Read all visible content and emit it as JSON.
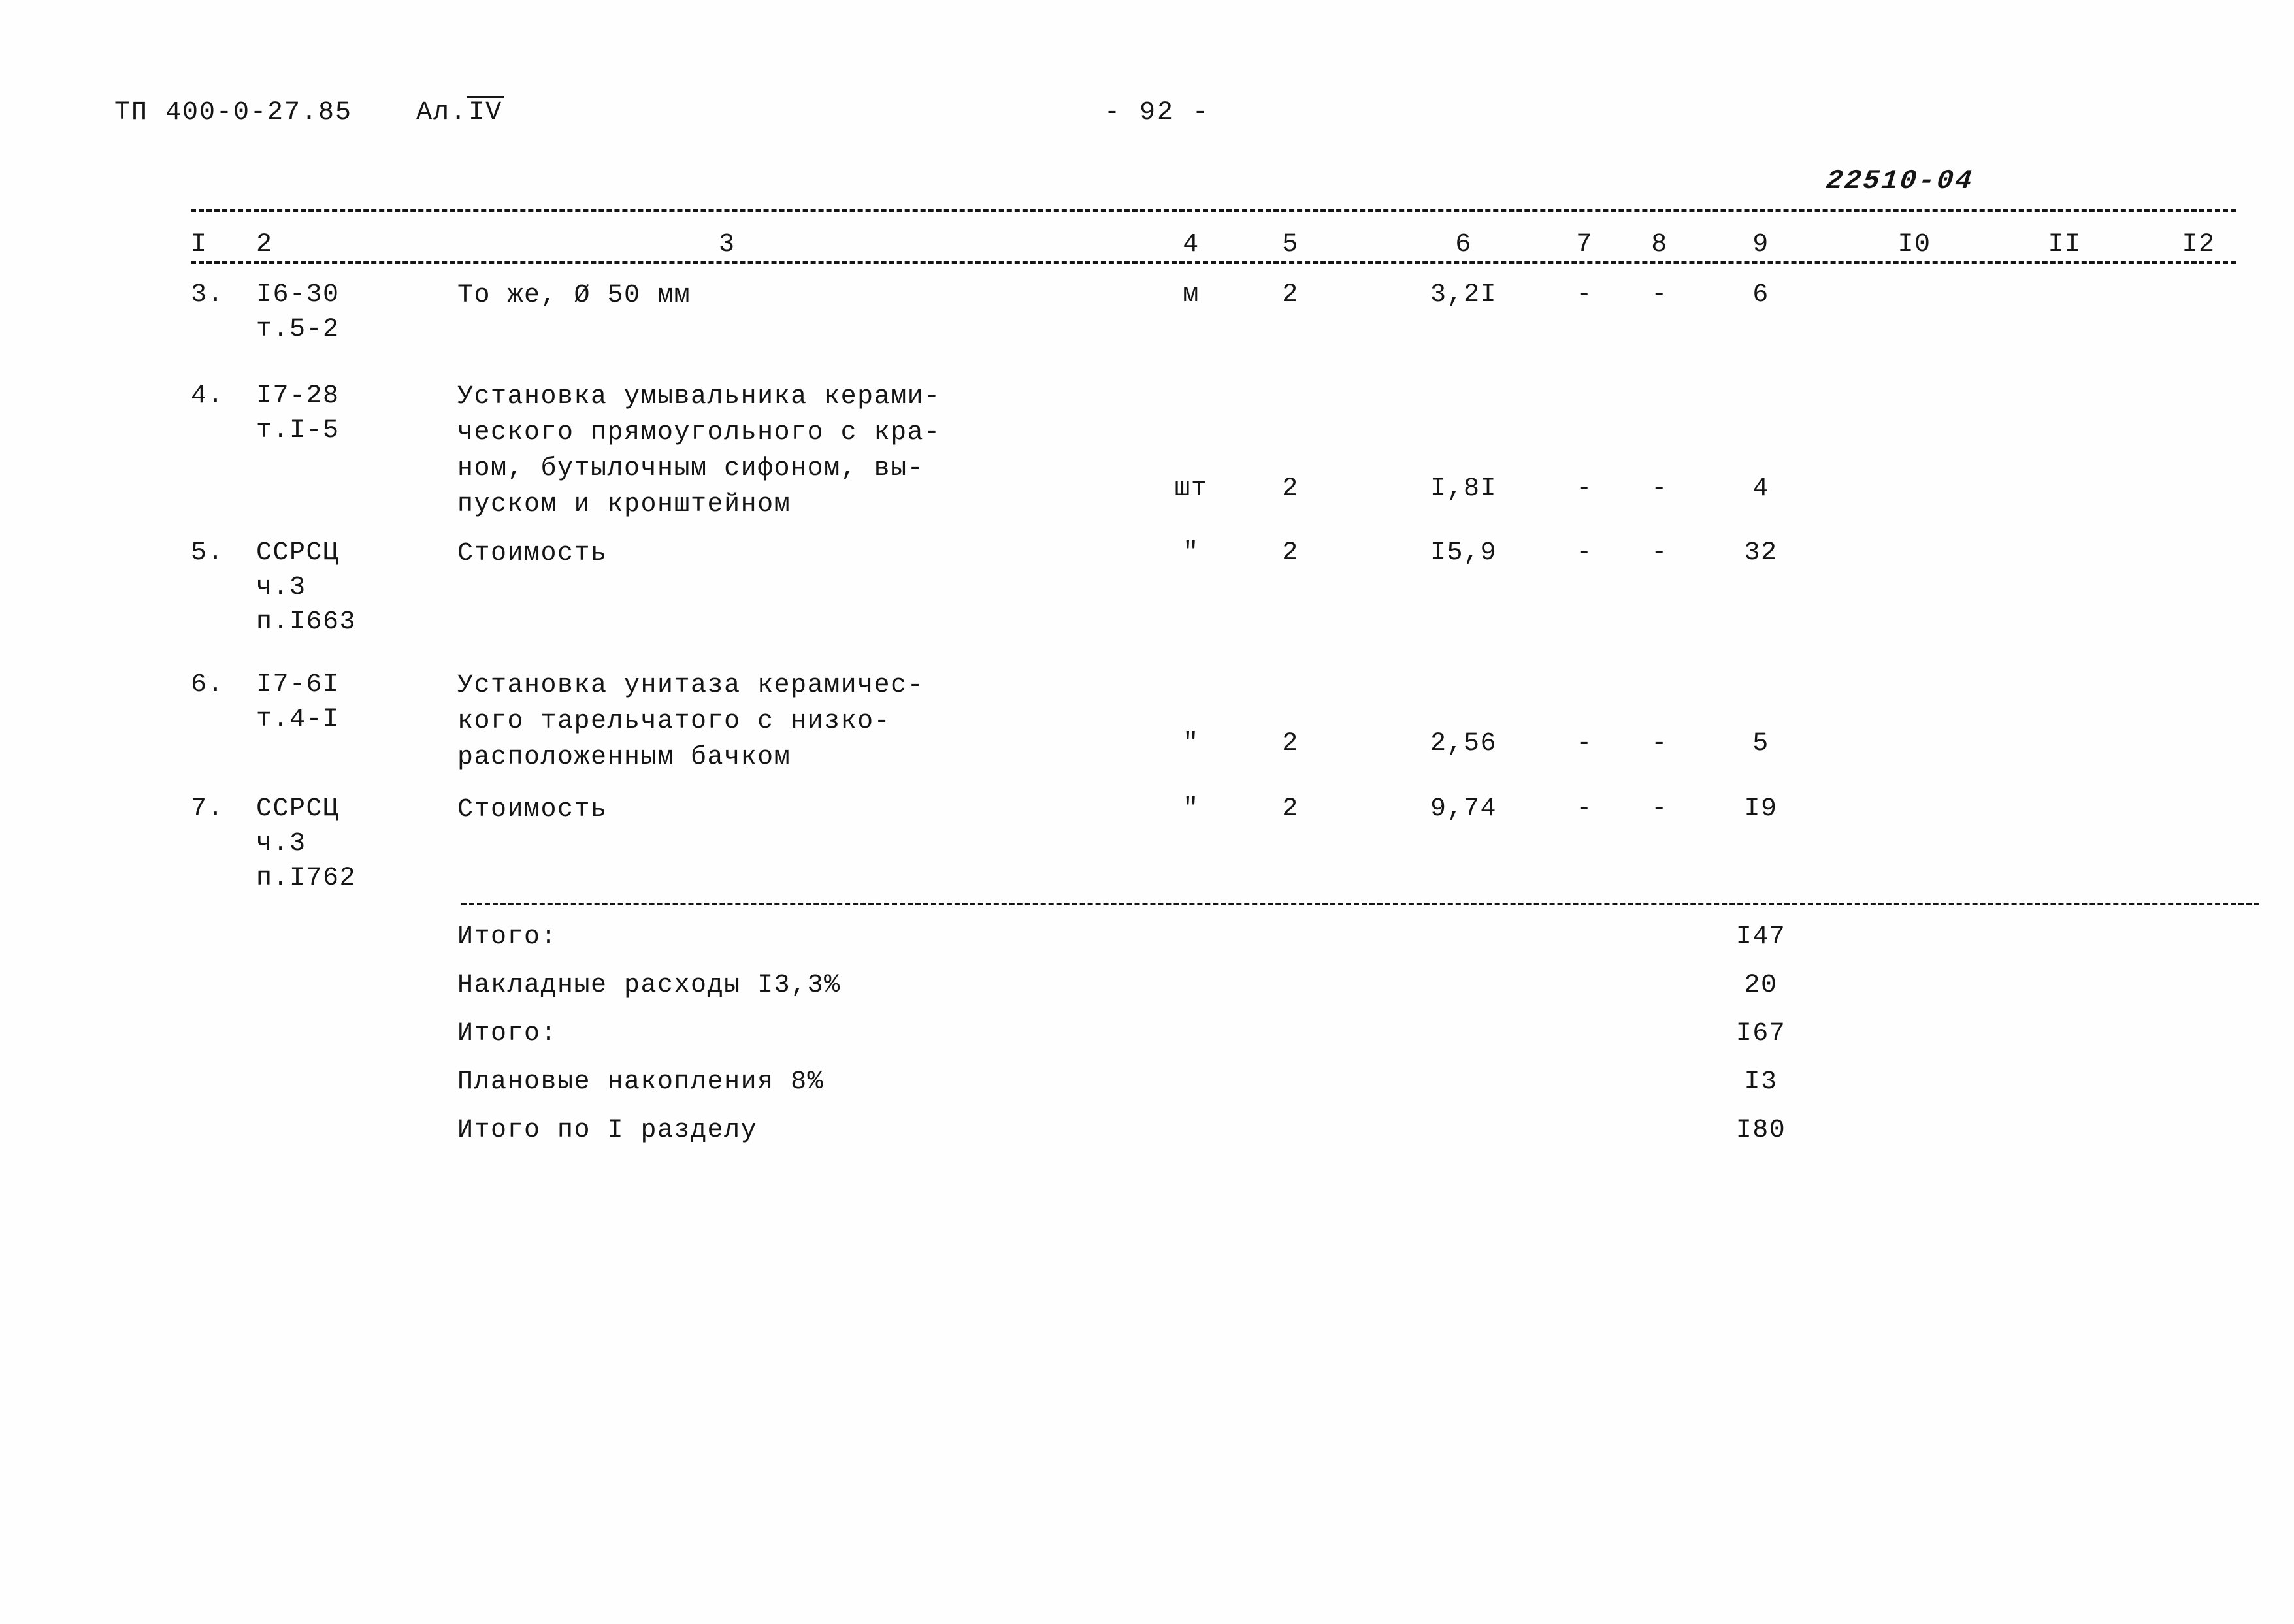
{
  "header": {
    "doc_code": "ТП 400-0-27.85",
    "album_label": "Ал.",
    "album_number": "IV",
    "page_number": "- 92 -",
    "stamp_code": "22510-04"
  },
  "table": {
    "column_headers": [
      "I",
      "2",
      "3",
      "4",
      "5",
      "6",
      "7",
      "8",
      "9",
      "I0",
      "II",
      "I2"
    ],
    "rows": [
      {
        "num": "3.",
        "code_lines": [
          "I6-30",
          "т.5-2"
        ],
        "description": [
          "То же, Ø 50 мм"
        ],
        "unit": "м",
        "qty": "2",
        "price": "3,2I",
        "col7": "-",
        "col8": "-",
        "col9": "6",
        "col10": "",
        "col11": "",
        "col12": ""
      },
      {
        "num": "4.",
        "code_lines": [
          "I7-28",
          "т.I-5"
        ],
        "description": [
          "Установка умывальника керами-",
          "ческого прямоугольного с кра-",
          "ном, бутылочным сифоном, вы-",
          "пуском и кронштейном"
        ],
        "unit": "шт",
        "qty": "2",
        "price": "I,8I",
        "col7": "-",
        "col8": "-",
        "col9": "4",
        "col10": "",
        "col11": "",
        "col12": ""
      },
      {
        "num": "5.",
        "code_lines": [
          "ССРСЦ",
          "ч.3",
          "п.I663"
        ],
        "description": [
          "Стоимость"
        ],
        "unit": "\"",
        "qty": "2",
        "price": "I5,9",
        "col7": "-",
        "col8": "-",
        "col9": "32",
        "col10": "",
        "col11": "",
        "col12": ""
      },
      {
        "num": "6.",
        "code_lines": [
          "I7-6I",
          "т.4-I"
        ],
        "description": [
          "Установка унитаза керамичес-",
          "кого тарельчатого с низко-",
          "расположенным бачком"
        ],
        "unit": "\"",
        "qty": "2",
        "price": "2,56",
        "col7": "-",
        "col8": "-",
        "col9": "5",
        "col10": "",
        "col11": "",
        "col12": ""
      },
      {
        "num": "7.",
        "code_lines": [
          "ССРСЦ",
          "ч.3",
          "п.I762"
        ],
        "description": [
          "Стоимость"
        ],
        "unit": "\"",
        "qty": "2",
        "price": "9,74",
        "col7": "-",
        "col8": "-",
        "col9": "I9",
        "col10": "",
        "col11": "",
        "col12": ""
      }
    ],
    "totals": [
      {
        "label": "Итого:",
        "value": "I47"
      },
      {
        "label": "Накладные расходы I3,3%",
        "value": "20"
      },
      {
        "label": "Итого:",
        "value": "I67"
      },
      {
        "label": "Плановые накопления 8%",
        "value": "I3"
      },
      {
        "label": "Итого по I разделу",
        "value": "I80"
      }
    ]
  }
}
